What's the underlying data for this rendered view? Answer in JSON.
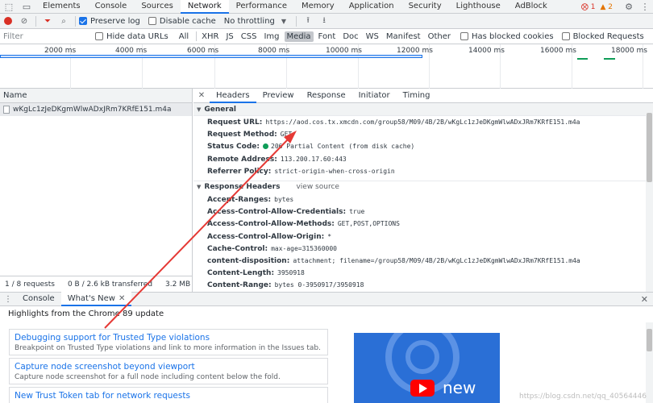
{
  "tabs": [
    "Elements",
    "Console",
    "Sources",
    "Network",
    "Performance",
    "Memory",
    "Application",
    "Security",
    "Lighthouse",
    "AdBlock"
  ],
  "active_tab": "Network",
  "badges": {
    "errors": "1",
    "warnings": "2"
  },
  "toolbar": {
    "preserve_log": "Preserve log",
    "disable_cache": "Disable cache",
    "throttling": "No throttling"
  },
  "filter": {
    "placeholder": "Filter",
    "hide_data_urls": "Hide data URLs",
    "types": [
      "All",
      "XHR",
      "JS",
      "CSS",
      "Img",
      "Media",
      "Font",
      "Doc",
      "WS",
      "Manifest",
      "Other"
    ],
    "active_type": "Media",
    "has_blocked_cookies": "Has blocked cookies",
    "blocked_requests": "Blocked Requests"
  },
  "timeline": {
    "ticks": [
      "2000 ms",
      "4000 ms",
      "6000 ms",
      "8000 ms",
      "10000 ms",
      "12000 ms",
      "14000 ms",
      "16000 ms",
      "18000 ms"
    ],
    "progress": 0.647
  },
  "request_list": {
    "header": "Name",
    "rows": [
      "wKgLc1zJeDKgmWlwADxJRm7KRfE151.m4a"
    ],
    "status": {
      "requests": "1 / 8 requests",
      "transferred": "0 B / 2.6 kB transferred",
      "resources": "3.2 MB / 6.6 MB re"
    }
  },
  "details": {
    "tabs": [
      "Headers",
      "Preview",
      "Response",
      "Initiator",
      "Timing"
    ],
    "active_tab": "Headers",
    "general_title": "General",
    "general": [
      {
        "k": "Request URL:",
        "v": "https://aod.cos.tx.xmcdn.com/group58/M09/4B/2B/wKgLc1zJeDKgmWlwADxJRm7KRfE151.m4a"
      },
      {
        "k": "Request Method:",
        "v": "GET"
      },
      {
        "k": "Status Code:",
        "v": "206 Partial Content (from disk cache)"
      },
      {
        "k": "Remote Address:",
        "v": "113.200.17.60:443"
      },
      {
        "k": "Referrer Policy:",
        "v": "strict-origin-when-cross-origin"
      }
    ],
    "response_title": "Response Headers",
    "view_source": "view source",
    "response": [
      {
        "k": "Accept-Ranges:",
        "v": "bytes"
      },
      {
        "k": "Access-Control-Allow-Credentials:",
        "v": "true"
      },
      {
        "k": "Access-Control-Allow-Methods:",
        "v": "GET,POST,OPTIONS"
      },
      {
        "k": "Access-Control-Allow-Origin:",
        "v": "*"
      },
      {
        "k": "Cache-Control:",
        "v": "max-age=315360000"
      },
      {
        "k": "content-disposition:",
        "v": "attachment; filename=/group58/M09/4B/2B/wKgLc1zJeDKgmWlwADxJRm7KRfE151.m4a"
      },
      {
        "k": "Content-Length:",
        "v": "3950918"
      },
      {
        "k": "Content-Range:",
        "v": "bytes 0-3950917/3950918"
      }
    ]
  },
  "drawer": {
    "tabs": [
      "Console",
      "What's New"
    ],
    "active_tab": "What's New",
    "title": "Highlights from the Chrome 89 update",
    "cards": [
      {
        "title": "Debugging support for Trusted Type violations",
        "desc": "Breakpoint on Trusted Type violations and link to more information in the Issues tab."
      },
      {
        "title": "Capture node screenshot beyond viewport",
        "desc": "Capture node screenshot for a full node including content below the fold."
      },
      {
        "title": "New Trust Token tab for network requests",
        "desc": ""
      }
    ],
    "video_text": "new"
  },
  "watermark": "https://blog.csdn.net/qq_40564446"
}
